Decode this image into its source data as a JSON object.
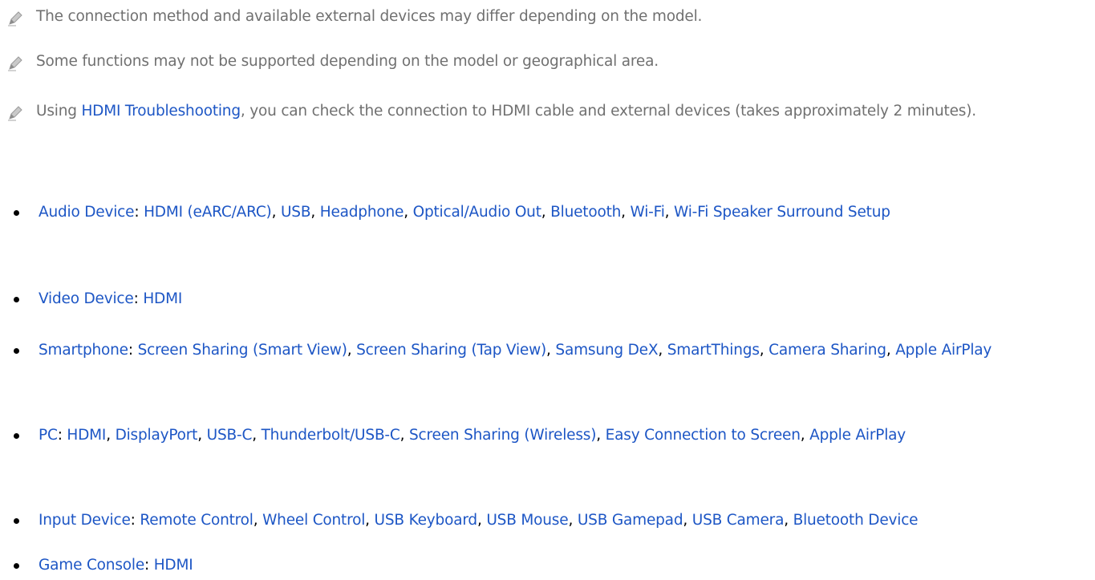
{
  "notes": [
    {
      "icon": "pencil-icon",
      "text": "The connection method and available external devices may differ depending on the model."
    },
    {
      "icon": "pencil-icon",
      "text": "Some functions may not be supported depending on the model or geographical area."
    },
    {
      "icon": "pencil-icon",
      "prefix": "Using ",
      "link": "HDMI Troubleshooting",
      "suffix": ", you can check the connection to HDMI cable and external devices (takes approximately 2 minutes)."
    }
  ],
  "categories": [
    {
      "label": "Audio Device",
      "items": [
        "HDMI (eARC/ARC)",
        "USB",
        "Headphone",
        "Optical/Audio Out",
        "Bluetooth",
        "Wi-Fi",
        "Wi-Fi Speaker Surround Setup"
      ]
    },
    {
      "label": "Video Device",
      "items": [
        "HDMI"
      ]
    },
    {
      "label": "Smartphone",
      "items": [
        "Screen Sharing (Smart View)",
        "Screen Sharing (Tap View)",
        "Samsung DeX",
        "SmartThings",
        "Camera Sharing",
        "Apple AirPlay"
      ]
    },
    {
      "label": "PC",
      "items": [
        "HDMI",
        "DisplayPort",
        "USB-C",
        "Thunderbolt/USB-C",
        "Screen Sharing (Wireless)",
        "Easy Connection to Screen",
        "Apple AirPlay"
      ]
    },
    {
      "label": "Input Device",
      "items": [
        "Remote Control",
        "Wheel Control",
        "USB Keyboard",
        "USB Mouse",
        "USB Gamepad",
        "USB Camera",
        "Bluetooth Device"
      ]
    },
    {
      "label": "Game Console",
      "items": [
        "HDMI"
      ]
    }
  ],
  "colors": {
    "link": "#1d56c5",
    "note_text": "#707070",
    "body_text": "#000000"
  }
}
